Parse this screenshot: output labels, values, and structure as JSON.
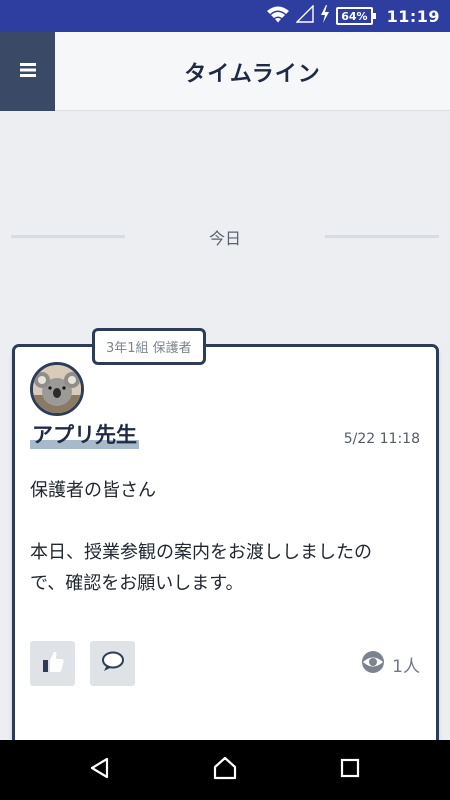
{
  "status_bar": {
    "battery_percent": "64%",
    "time": "11:19",
    "icons": [
      "wifi-icon",
      "cellular-signal-icon",
      "charging-bolt-icon",
      "battery-icon"
    ]
  },
  "header": {
    "title": "タイムライン",
    "menu_icon": "hamburger-menu-icon"
  },
  "timeline": {
    "date_divider": "今日",
    "post": {
      "group_tag": "3年1組 保護者",
      "author_name": "アプリ先生",
      "timestamp": "5/22 11:18",
      "body": {
        "greeting": "保護者の皆さん",
        "line1": "本日、授業参観の案内をお渡ししましたの",
        "line2": "で、確認をお願いします。"
      },
      "actions": {
        "like_icon": "thumbs-up-icon",
        "comment_icon": "speech-bubble-icon"
      },
      "read_count": "1人",
      "read_icon": "eye-icon"
    }
  },
  "nav_bar": {
    "buttons": [
      "back-triangle-icon",
      "home-icon",
      "recents-square-icon"
    ]
  },
  "colors": {
    "status_bar": "#2e3ea0",
    "accent_navy": "#2f3c58",
    "menu_button": "#3a4966",
    "background": "#eceef1",
    "name_highlight": "#a7b9ca"
  }
}
